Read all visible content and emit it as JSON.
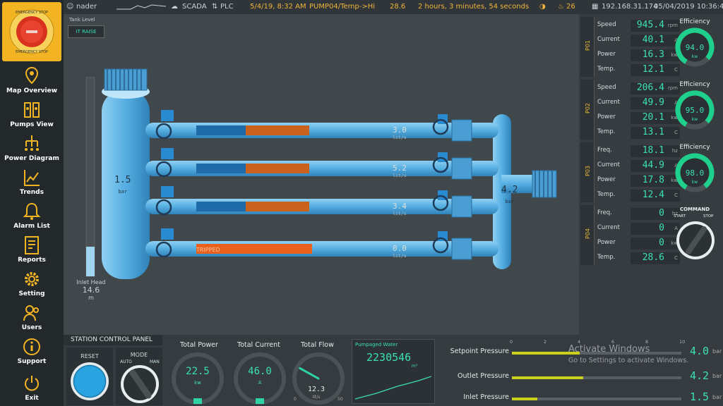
{
  "topbar": {
    "user": "nader",
    "system": "SCADA",
    "link": "PLC",
    "datetime": "5/4/19, 8:32 AM",
    "alarm_text": "PUMP04/Temp->Hi",
    "alarm_value": "28.6",
    "duration": "2 hours,  3 minutes,  54 seconds",
    "alarm_count": "26",
    "ip": "192.168.31.174",
    "clock": "05/04/2019 10:36:49"
  },
  "estop": {
    "label": "EMERGENCY STOP"
  },
  "nav": [
    {
      "label": "Map Overview"
    },
    {
      "label": "Pumps View"
    },
    {
      "label": "Power Diagram"
    },
    {
      "label": "Trends"
    },
    {
      "label": "Alarm List"
    },
    {
      "label": "Reports"
    },
    {
      "label": "Setting"
    },
    {
      "label": "Users"
    },
    {
      "label": "Support"
    },
    {
      "label": "Exit"
    }
  ],
  "process": {
    "tank_level_label": "Tank Level",
    "tank_level_button": "IT RAISE",
    "inlet_pressure": "1.5",
    "inlet_pressure_unit": "bar",
    "outlet_pressure": "4.2",
    "outlet_pressure_unit": "bar",
    "inlet_head_label": "Inlet Head",
    "inlet_head_value": "14.6",
    "inlet_head_unit": "m",
    "tripped_label": "TRIPPED",
    "flow_unit": "lit/s",
    "pipes": [
      {
        "flow": "3.0"
      },
      {
        "flow": "5.2"
      },
      {
        "flow": "3.4"
      },
      {
        "flow": "0.0"
      }
    ]
  },
  "pumps": [
    {
      "name": "P01",
      "efficiency_label": "Efficiency",
      "efficiency": "94.0",
      "efficiency_fraction": 0.94,
      "efficiency_unit": "kw",
      "rows": [
        {
          "label": "Speed",
          "value": "945.4",
          "unit": "rpm"
        },
        {
          "label": "Current",
          "value": "40.1",
          "unit": "A"
        },
        {
          "label": "Power",
          "value": "16.3",
          "unit": "kw"
        },
        {
          "label": "Temp.",
          "value": "12.1",
          "unit": "C"
        }
      ]
    },
    {
      "name": "P02",
      "efficiency_label": "Efficiency",
      "efficiency": "95.0",
      "efficiency_fraction": 0.95,
      "efficiency_unit": "kw",
      "rows": [
        {
          "label": "Speed",
          "value": "206.4",
          "unit": "rpm"
        },
        {
          "label": "Current",
          "value": "49.9",
          "unit": "A"
        },
        {
          "label": "Power",
          "value": "20.1",
          "unit": "kw"
        },
        {
          "label": "Temp.",
          "value": "13.1",
          "unit": "C"
        }
      ]
    },
    {
      "name": "P03",
      "efficiency_label": "Efficiency",
      "efficiency": "98.0",
      "efficiency_fraction": 0.98,
      "efficiency_unit": "kw",
      "rows": [
        {
          "label": "Freq.",
          "value": "18.1",
          "unit": "hz"
        },
        {
          "label": "Current",
          "value": "44.9",
          "unit": "A"
        },
        {
          "label": "Power",
          "value": "17.8",
          "unit": "kw"
        },
        {
          "label": "Temp.",
          "value": "12.4",
          "unit": "C"
        }
      ]
    },
    {
      "name": "P04",
      "command_label": "COMMAND",
      "start_label": "START",
      "stop_label": "STOP",
      "rows": [
        {
          "label": "Freq.",
          "value": "0",
          "unit": "hz"
        },
        {
          "label": "Current",
          "value": "0",
          "unit": "A"
        },
        {
          "label": "Power",
          "value": "0",
          "unit": "kw"
        },
        {
          "label": "Temp.",
          "value": "28.6",
          "unit": "C"
        }
      ]
    }
  ],
  "control": {
    "title": "STATION CONTROL PANEL",
    "reset_label": "RESET",
    "mode_label": "MODE",
    "auto_label": "AUTO",
    "man_label": "MAN",
    "total_power_label": "Total Power",
    "total_power": "22.5",
    "total_power_unit": "kw",
    "total_current_label": "Total Current",
    "total_current": "46.0",
    "total_current_unit": "A",
    "total_flow_label": "Total Flow",
    "total_flow": "12.3",
    "total_flow_unit": "lit/s",
    "total_flow_min": "0",
    "total_flow_max": "50",
    "pumped_label": "Pumpaged Water",
    "pumped_value": "2230546",
    "pumped_unit": "m³",
    "scale_ticks": [
      "0",
      "2",
      "4",
      "6",
      "8",
      "10"
    ],
    "pressures": [
      {
        "label": "Setpoint Pressure",
        "value": "4.0",
        "unit": "bar",
        "fraction": 0.4
      },
      {
        "label": "Outlet Pressure",
        "value": "4.2",
        "unit": "bar",
        "fraction": 0.42
      },
      {
        "label": "Inlet Pressure",
        "value": "1.5",
        "unit": "bar",
        "fraction": 0.15
      }
    ]
  },
  "watermark": {
    "line1": "Activate Windows",
    "line2": "Go to Settings to activate Windows."
  },
  "colors": {
    "accent": "#3ce0b8",
    "pipe": "#5ab4e6",
    "alarm": "#f2b422",
    "tripped": "#e85a1a"
  }
}
